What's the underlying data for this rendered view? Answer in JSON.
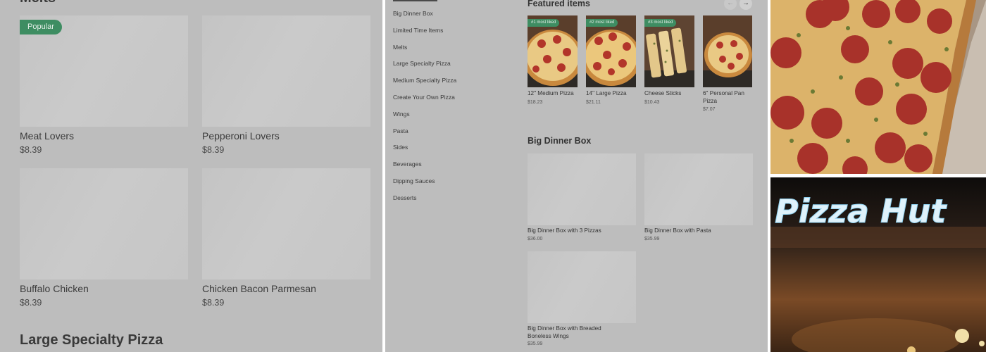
{
  "melts_panel": {
    "section_title": "Melts",
    "popular_badge": "Popular",
    "items": [
      {
        "name": "Meat Lovers",
        "price": "$8.39"
      },
      {
        "name": "Pepperoni Lovers",
        "price": "$8.39"
      },
      {
        "name": "Buffalo Chicken",
        "price": "$8.39"
      },
      {
        "name": "Chicken Bacon Parmesan",
        "price": "$8.39"
      }
    ],
    "next_section_title": "Large Specialty Pizza"
  },
  "menu_panel": {
    "nav": [
      "Big Dinner Box",
      "Limited Time Items",
      "Melts",
      "Large Specialty Pizza",
      "Medium Specialty Pizza",
      "Create Your Own Pizza",
      "Wings",
      "Pasta",
      "Sides",
      "Beverages",
      "Dipping Sauces",
      "Desserts"
    ],
    "featured": {
      "title": "Featured items",
      "prev_icon": "←",
      "next_icon": "→",
      "items": [
        {
          "badge": "#1 most liked",
          "name": "12\" Medium Pizza",
          "price": "$18.23"
        },
        {
          "badge": "#2 most liked",
          "name": "14\" Large Pizza",
          "price": "$21.11"
        },
        {
          "badge": "#3 most liked",
          "name": "Cheese Sticks",
          "price": "$10.43"
        },
        {
          "badge": "",
          "name": "6\" Personal Pan Pizza",
          "price": "$7.07"
        }
      ]
    },
    "big_dinner_box": {
      "title": "Big Dinner Box",
      "items": [
        {
          "name": "Big Dinner Box with 3 Pizzas",
          "price": "$36.00"
        },
        {
          "name": "Big Dinner Box with Pasta",
          "price": "$35.99"
        },
        {
          "name": "Big Dinner Box with Breaded Boneless Wings",
          "price": "$35.99"
        }
      ]
    }
  },
  "photos": {
    "sign_text": "Pizza Hut"
  },
  "colors": {
    "overlay_gray": "#bdbdbd",
    "badge_green": "#3e8d62"
  }
}
